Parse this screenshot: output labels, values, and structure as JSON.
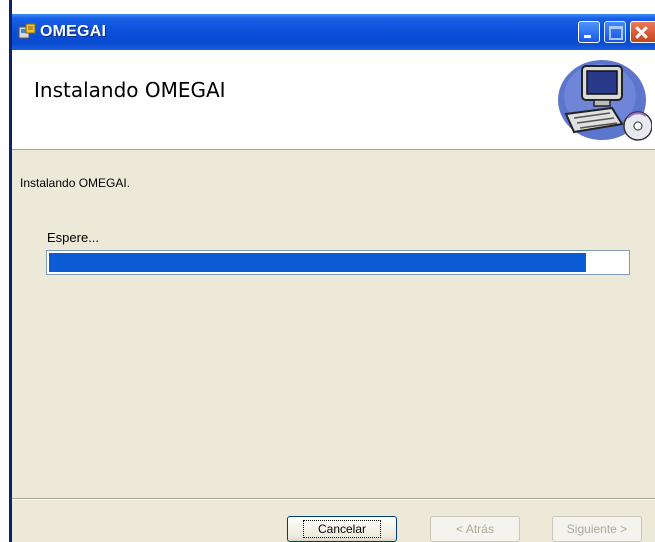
{
  "window": {
    "title": "OMEGAI"
  },
  "banner": {
    "title": "Instalando OMEGAI"
  },
  "content": {
    "status": "Instalando OMEGAI.",
    "wait_label": "Espere...",
    "progress": 0.93
  },
  "buttons": {
    "cancel": "Cancelar",
    "back": "< Atrás",
    "next": "Siguiente >"
  },
  "colors": {
    "titlebar": "#0a4fd8",
    "progress_fill": "#0b5bd4",
    "dialog_bg": "#ece9d8"
  }
}
